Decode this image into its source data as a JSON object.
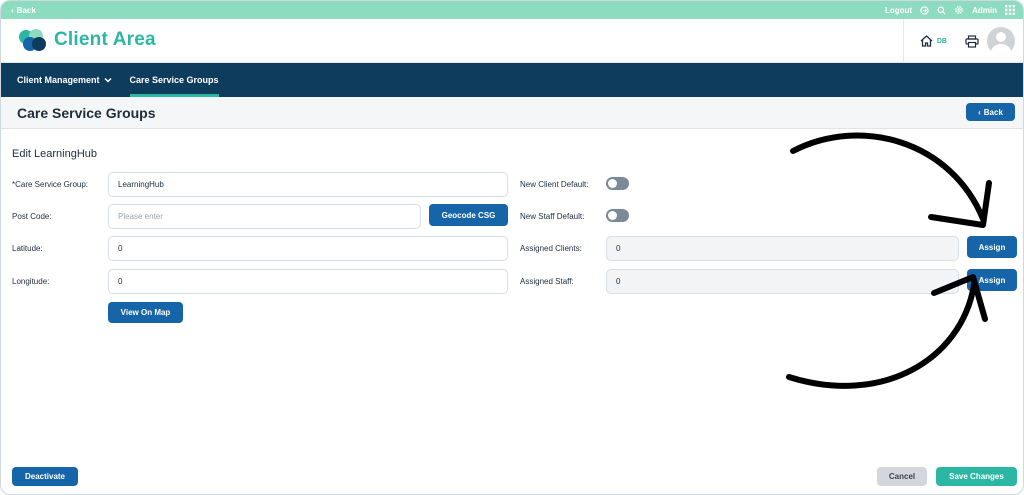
{
  "topbar": {
    "back_label": "Back",
    "logout_label": "Logout",
    "user_label": "Admin"
  },
  "header": {
    "brand_title": "Client Area",
    "home_initials": "DB"
  },
  "nav": {
    "items": [
      {
        "label": "Client Management"
      },
      {
        "label": "Care Service Groups"
      }
    ]
  },
  "page": {
    "title": "Care Service Groups",
    "back_label": "Back"
  },
  "form": {
    "title": "Edit LearningHub",
    "care_service_group": {
      "label": "*Care Service Group:",
      "value": "LearningHub"
    },
    "post_code": {
      "label": "Post Code:",
      "placeholder": "Please enter"
    },
    "geocode_label": "Geocode CSG",
    "latitude": {
      "label": "Latitude:",
      "value": "0"
    },
    "longitude": {
      "label": "Longitude:",
      "value": "0"
    },
    "view_on_map_label": "View On Map",
    "new_client_default": {
      "label": "New Client Default:",
      "enabled": false
    },
    "new_staff_default": {
      "label": "New Staff Default:",
      "enabled": false
    },
    "assigned_clients": {
      "label": "Assigned Clients:",
      "value": "0",
      "action_label": "Assign"
    },
    "assigned_staff": {
      "label": "Assigned Staff:",
      "value": "0",
      "action_label": "Assign"
    }
  },
  "footer": {
    "deactivate_label": "Deactivate",
    "cancel_label": "Cancel",
    "save_label": "Save Changes"
  },
  "colors": {
    "accent_green": "#2bb7a3",
    "topbar_mint": "#8edcc0",
    "nav_navy": "#0d3c5c",
    "primary_blue": "#1565a8"
  }
}
